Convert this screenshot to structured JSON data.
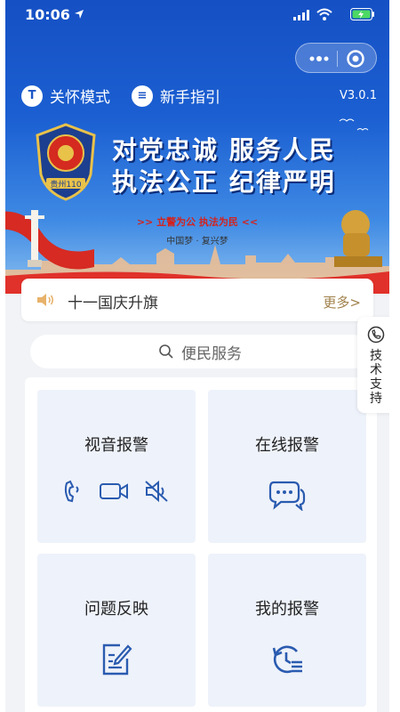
{
  "status": {
    "time": "10:06"
  },
  "topbar": {
    "care_mode_icon": "T",
    "care_mode_label": "关怀模式",
    "guide_icon": "≡",
    "guide_label": "新手指引",
    "version": "V3.0.1"
  },
  "banner": {
    "emblem_text": "贵州110",
    "slogan_line1": "对党忠诚  服务人民",
    "slogan_line2": "执法公正  纪律严明",
    "sub_slogan": ">>  立警为公  执法为民  <<",
    "sub_slogan2": "中国梦 · 复兴梦"
  },
  "notice": {
    "text": "十一国庆升旗",
    "more": "更多>"
  },
  "search": {
    "placeholder": "便民服务"
  },
  "tech_support": {
    "label": "技术支持"
  },
  "services": [
    {
      "title": "视音报警",
      "icons": [
        "phone-icon",
        "video-camera-icon",
        "mute-speaker-icon"
      ]
    },
    {
      "title": "在线报警",
      "icons": [
        "chat-bubbles-icon"
      ]
    },
    {
      "title": "问题反映",
      "icons": [
        "edit-document-icon"
      ]
    },
    {
      "title": "我的报警",
      "icons": [
        "history-list-icon"
      ]
    }
  ],
  "colors": {
    "brand_blue": "#1b5fd2",
    "icon_blue": "#2a5bb0",
    "card_bg": "#eef2fa",
    "more_gold": "#a0814a"
  }
}
